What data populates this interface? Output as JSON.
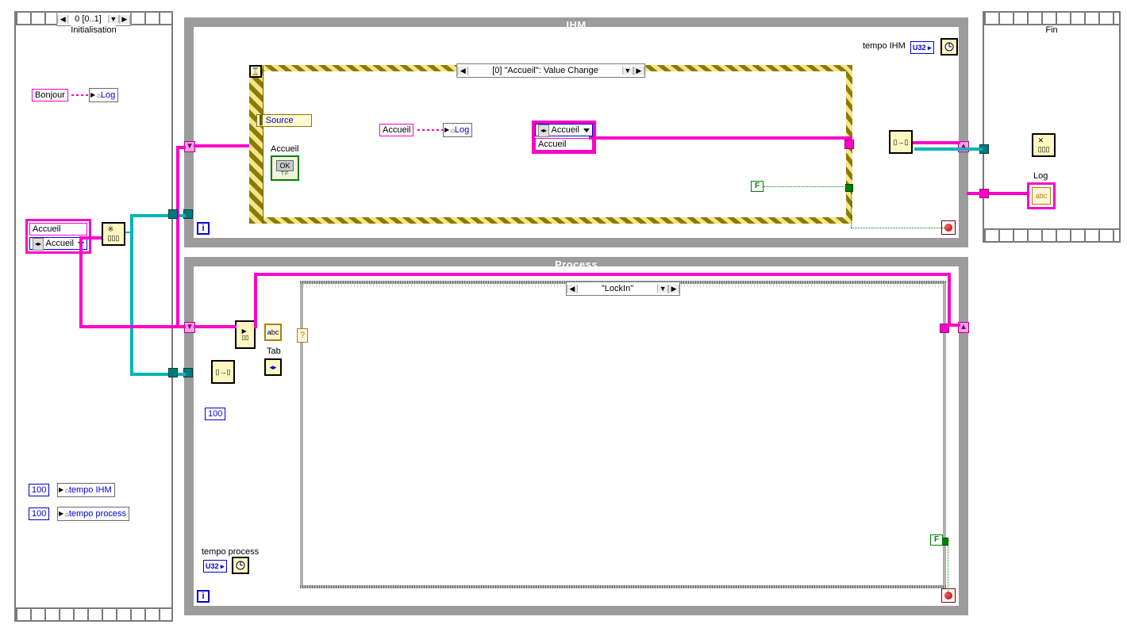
{
  "init": {
    "frame_title": "Initialisation",
    "seq_index": "0 [0..1]",
    "bonjour": "Bonjour",
    "log_local": "Log",
    "accueil_label": "Accueil",
    "accueil_ring": "Accueil",
    "const_100_a": "100",
    "const_100_b": "100",
    "tempo_ihm": "tempo IHM",
    "tempo_process": "tempo process"
  },
  "ihm": {
    "title": "IHM",
    "tempo_label": "tempo IHM",
    "u32": "U32",
    "event_case": "[0] \"Accueil\": Value Change",
    "source_node": "Source",
    "accueil_ctl_label": "Accueil",
    "accueil_ok": "OK",
    "accueil_str": "Accueil",
    "accueil_ring": "Accueil",
    "accueil_case": "Accueil",
    "log_local": "Log",
    "bool_f": "F"
  },
  "process": {
    "title": "Process",
    "tab_label": "Tab",
    "case": "\"LockIn\"",
    "const_100": "100",
    "tempo_label": "tempo process",
    "u32": "U32",
    "bool_f": "F"
  },
  "fin": {
    "frame_title": "Fin",
    "log_label": "Log",
    "log_abc": "abc"
  }
}
